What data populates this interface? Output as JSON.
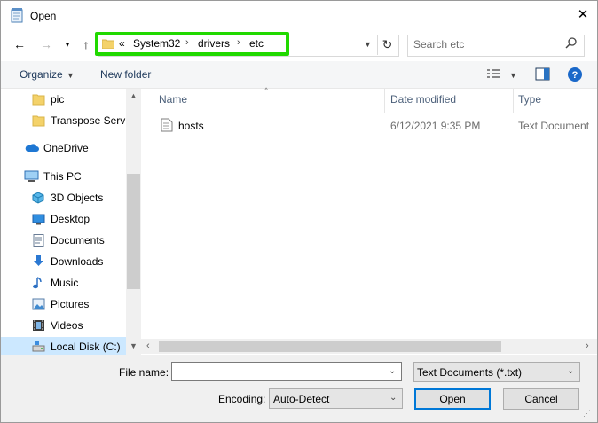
{
  "window": {
    "title": "Open"
  },
  "address": {
    "overflow": "«",
    "crumbs": [
      "System32",
      "drivers",
      "etc"
    ]
  },
  "search": {
    "placeholder": "Search etc"
  },
  "toolbar": {
    "organize": "Organize",
    "new_folder": "New folder"
  },
  "nav": {
    "items": [
      {
        "label": "pic",
        "icon": "folder-icon"
      },
      {
        "label": "Transpose Servic",
        "icon": "folder-icon"
      },
      {
        "label": "OneDrive",
        "icon": "cloud-icon"
      },
      {
        "label": "This PC",
        "icon": "computer-icon"
      },
      {
        "label": "3D Objects",
        "icon": "cube-icon"
      },
      {
        "label": "Desktop",
        "icon": "desktop-icon"
      },
      {
        "label": "Documents",
        "icon": "document-icon"
      },
      {
        "label": "Downloads",
        "icon": "download-icon"
      },
      {
        "label": "Music",
        "icon": "music-icon"
      },
      {
        "label": "Pictures",
        "icon": "pictures-icon"
      },
      {
        "label": "Videos",
        "icon": "videos-icon"
      },
      {
        "label": "Local Disk (C:)",
        "icon": "drive-icon"
      }
    ]
  },
  "columns": {
    "name": "Name",
    "date": "Date modified",
    "type": "Type"
  },
  "files": [
    {
      "name": "hosts",
      "date": "6/12/2021 9:35 PM",
      "type": "Text Document",
      "icon": "text-file-icon"
    }
  ],
  "bottom": {
    "file_name_label": "File name:",
    "file_name_value": "",
    "file_type": "Text Documents (*.txt)",
    "encoding_label": "Encoding:",
    "encoding_value": "Auto-Detect",
    "open": "Open",
    "cancel": "Cancel"
  },
  "colors": {
    "highlight": "#21d900",
    "accent": "#0078d7",
    "selection": "#cce8ff"
  }
}
